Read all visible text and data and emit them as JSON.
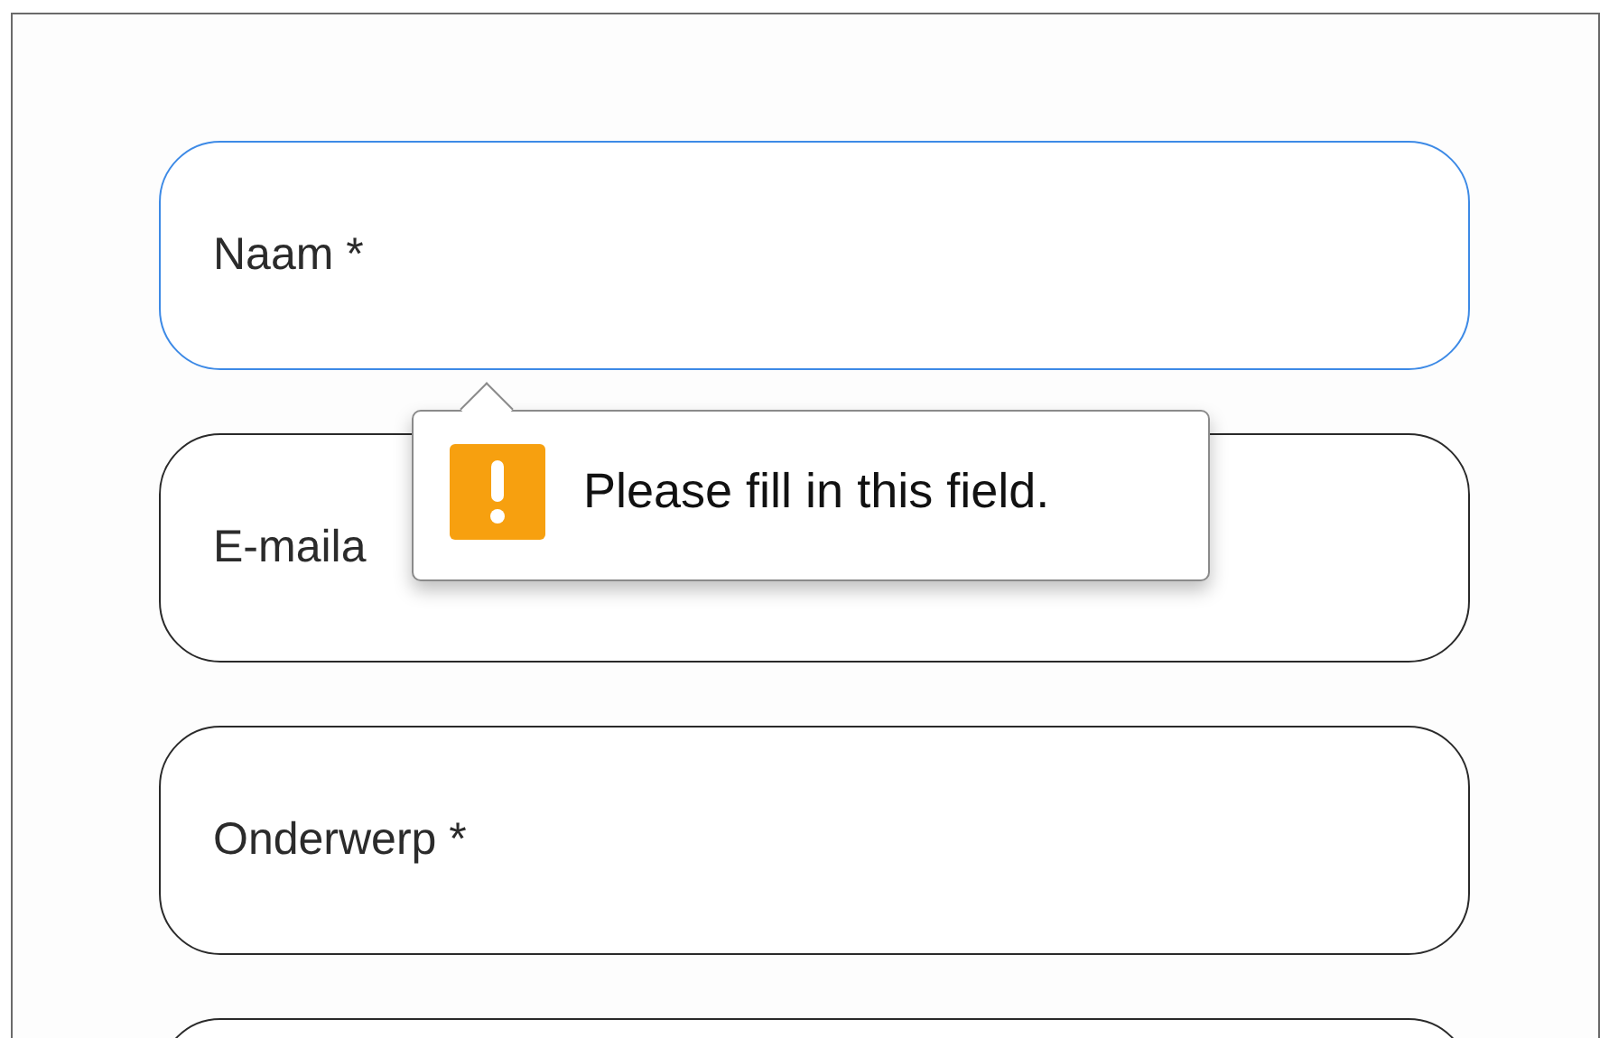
{
  "fields": [
    {
      "placeholder": "Naam *",
      "focused": true
    },
    {
      "placeholder": "E-maila",
      "focused": false
    },
    {
      "placeholder": "Onderwerp *",
      "focused": false
    },
    {
      "focused": false
    }
  ],
  "validation_tooltip": {
    "message": "Please fill in this field."
  }
}
